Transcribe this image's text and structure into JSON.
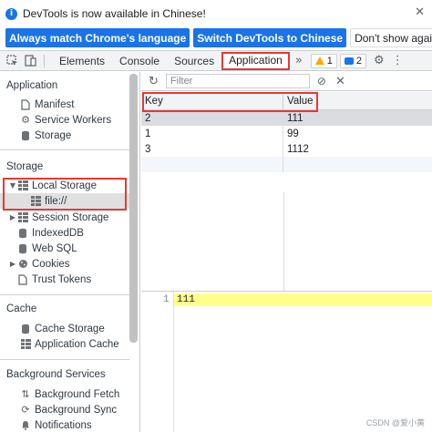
{
  "notice": {
    "text": "DevTools is now available in Chinese!",
    "btn_match": "Always match Chrome's language",
    "btn_switch": "Switch DevTools to Chinese",
    "btn_dont_show": "Don't show again",
    "close": "✕"
  },
  "toolbar": {
    "tabs": [
      "Elements",
      "Console",
      "Sources",
      "Application"
    ],
    "active_tab": "Application",
    "more": "»",
    "warnings": "1",
    "messages": "2"
  },
  "sidebar": {
    "application_title": "Application",
    "application_items": [
      "Manifest",
      "Service Workers",
      "Storage"
    ],
    "storage_title": "Storage",
    "local_storage": "Local Storage",
    "local_storage_child": "file://",
    "storage_items": [
      "Session Storage",
      "IndexedDB",
      "Web SQL",
      "Cookies",
      "Trust Tokens"
    ],
    "cache_title": "Cache",
    "cache_items": [
      "Cache Storage",
      "Application Cache"
    ],
    "bg_title": "Background Services",
    "bg_items": [
      "Background Fetch",
      "Background Sync",
      "Notifications"
    ]
  },
  "main": {
    "filter_placeholder": "Filter",
    "columns": {
      "key": "Key",
      "value": "Value"
    },
    "rows": [
      {
        "key": "2",
        "value": "111"
      },
      {
        "key": "1",
        "value": "99"
      },
      {
        "key": "3",
        "value": "1112"
      }
    ],
    "preview_line_number": "1",
    "preview_value": "111"
  },
  "watermark": "CSDN @爱小黄",
  "colors": {
    "accent": "#1a73e8",
    "highlight_box": "#e53935",
    "preview_highlight": "#ffff8c"
  }
}
